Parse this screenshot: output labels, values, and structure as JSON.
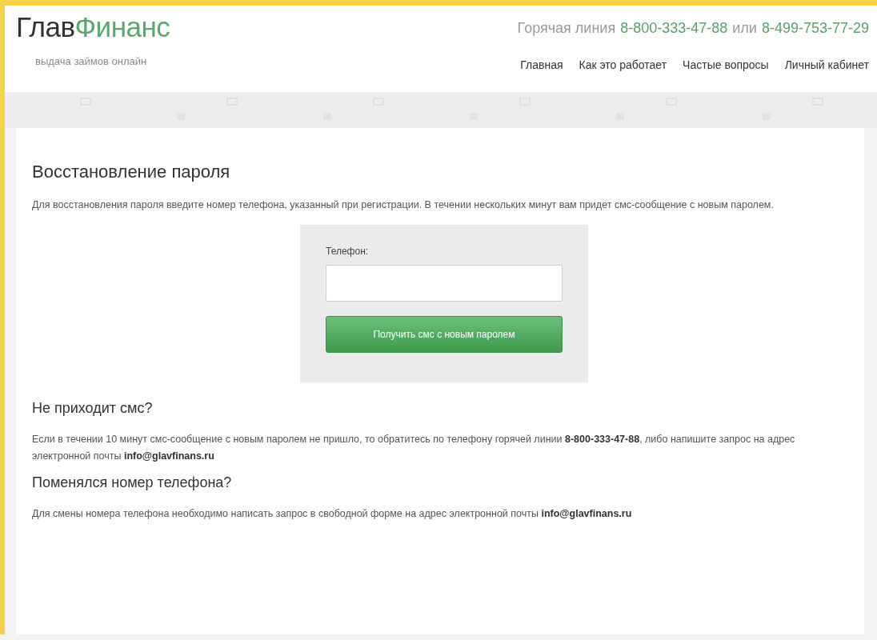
{
  "header": {
    "logo": {
      "part1": "Глав",
      "part2": "Финанс"
    },
    "tagline": "выдача займов онлайн",
    "hotline": {
      "label": "Горячая линия",
      "phone1": "8-800-333-47-88",
      "joiner": "или",
      "phone2": "8-499-753-77-29"
    },
    "nav": [
      {
        "label": "Главная"
      },
      {
        "label": "Как это работает"
      },
      {
        "label": "Частые вопросы"
      },
      {
        "label": "Личный кабинет"
      }
    ]
  },
  "main": {
    "title": "Восстановление пароля",
    "intro": "Для восстановления пароля введите номер телефона, указанный при регистрации. В течении нескольких минут вам придет смс-сообщение с новым паролем.",
    "form": {
      "label": "Телефон:",
      "button": "Получить смс с новым паролем"
    },
    "sections": [
      {
        "heading": "Не приходит смс?",
        "text": "Если в течении 10 минут смс-сообщение с новым паролем не пришло, то обратитесь по телефону горячей линии **8-800-333-47-88**, либо напишите запрос на адрес электронной почты **info@glavfinans.ru**"
      },
      {
        "heading": "Поменялся номер телефона?",
        "text": "Для смены номера телефона необходимо написать запрос в свободной форме на адрес электронной почты **info@glavfinans.ru**"
      }
    ]
  }
}
